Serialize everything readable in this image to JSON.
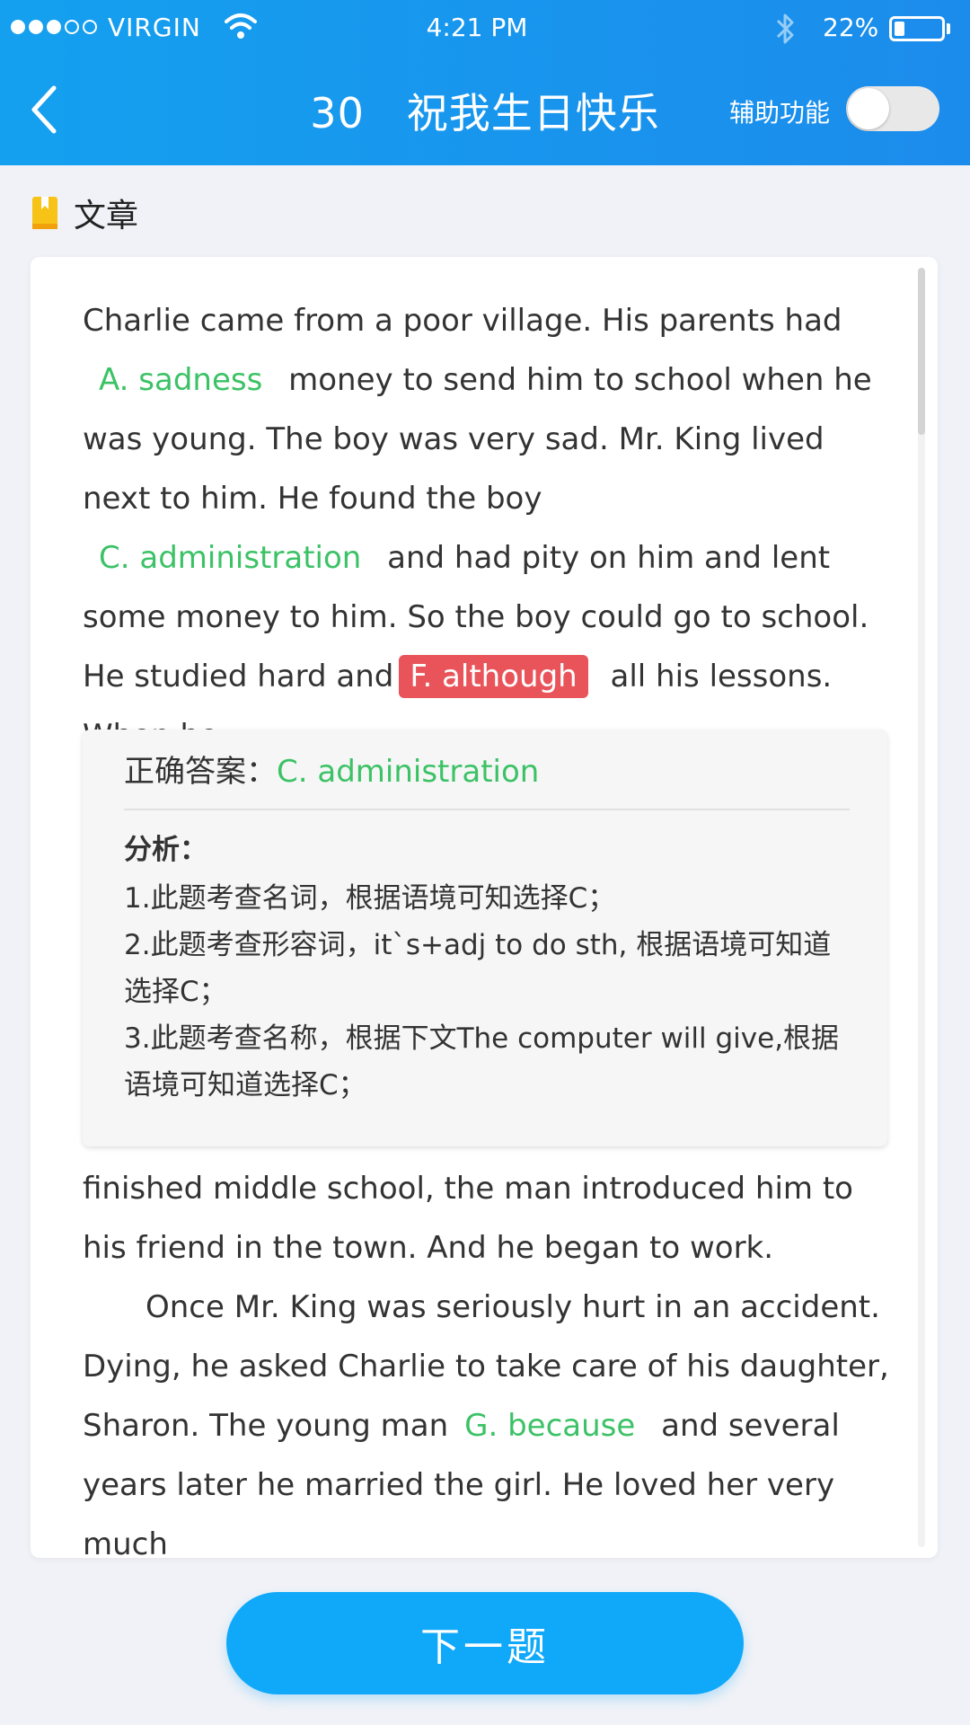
{
  "status_bar": {
    "carrier": "VIRGIN",
    "time": "4:21 PM",
    "battery": "22%",
    "battery_level": 0.22,
    "signal_filled": 3,
    "signal_total": 5
  },
  "header": {
    "title": "30   祝我生日快乐",
    "assist_label": "辅助功能",
    "assist_on": false
  },
  "section": {
    "title": "文章"
  },
  "passage_top": {
    "t1": "Charlie came from a poor village. His parents had",
    "a1": "A. sadness",
    "t2": " money to send him to school when he was young. The boy was very sad. Mr. King lived next to him. He found the boy",
    "a2": "C. administration",
    "t3": " and had pity on him and lent some money to him. So the boy could go to school. He studied hard and",
    "a3": "F. although",
    "t4": " all his lessons. When he"
  },
  "analysis": {
    "correct_label": "正确答案：",
    "correct_value": "C. administration",
    "title": "分析：",
    "lines": [
      "1.此题考查名词，根据语境可知选择C；",
      "2.此题考查形容词，it`s+adj to do sth, 根据语境可知道选择C；",
      "3.此题考查名称，根据下文The computer will give,根据语境可知道选择C；"
    ]
  },
  "passage_bottom": {
    "t1": " finished middle school, the man introduced him to his friend in the town. And he began to work.",
    "t2": "Once Mr. King was seriously hurt in an accident. Dying, he asked Charlie to take care of his daughter, Sharon. The young man",
    "a1": "G. because",
    "t3": " and several years later he married the girl. He loved her very much"
  },
  "next_button": "下一题",
  "colors": {
    "header": "#1c8cec",
    "correct": "#3cc266",
    "wrong": "#e8545a",
    "button": "#10a9fa",
    "book_icon": "#f7c316"
  }
}
